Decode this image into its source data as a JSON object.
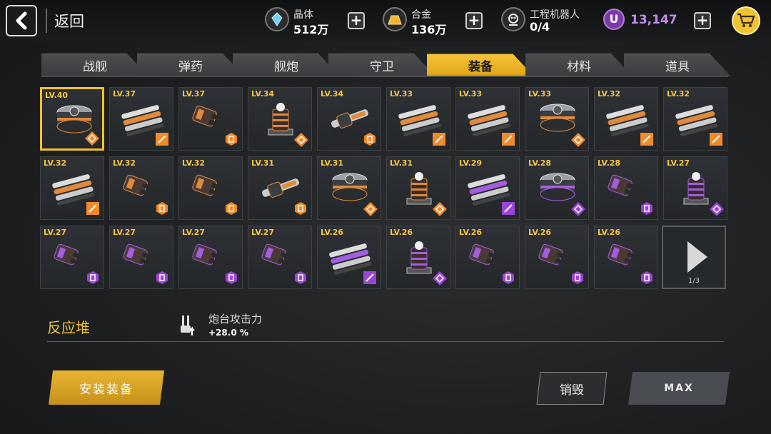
{
  "header": {
    "back_label": "返回",
    "resources": [
      {
        "name": "crystal-icon",
        "label": "晶体",
        "value": "512万"
      },
      {
        "name": "alloy-icon",
        "label": "合金",
        "value": "136万"
      },
      {
        "name": "robot-icon",
        "label": "工程机器人",
        "value": "0/4"
      }
    ],
    "currency_value": "13,147",
    "currency_icon_letter": "U"
  },
  "tabs": [
    {
      "label": "战舰",
      "active": false
    },
    {
      "label": "弹药",
      "active": false
    },
    {
      "label": "舰炮",
      "active": false
    },
    {
      "label": "守卫",
      "active": false
    },
    {
      "label": "装备",
      "active": true
    },
    {
      "label": "材料",
      "active": false
    },
    {
      "label": "道具",
      "active": false
    }
  ],
  "items": [
    {
      "level": "LV.40",
      "type": "core",
      "tier": "orange",
      "badge": "diamond",
      "selected": true
    },
    {
      "level": "LV.37",
      "type": "armor",
      "tier": "orange",
      "badge": "square"
    },
    {
      "level": "LV.37",
      "type": "cannon",
      "tier": "orange",
      "badge": "hex"
    },
    {
      "level": "LV.34",
      "type": "tower",
      "tier": "orange",
      "badge": "diamond"
    },
    {
      "level": "LV.34",
      "type": "rail",
      "tier": "orange",
      "badge": "hex"
    },
    {
      "level": "LV.33",
      "type": "armor",
      "tier": "orange",
      "badge": "square"
    },
    {
      "level": "LV.33",
      "type": "armor",
      "tier": "orange",
      "badge": "square"
    },
    {
      "level": "LV.33",
      "type": "core",
      "tier": "orange",
      "badge": "diamond"
    },
    {
      "level": "LV.32",
      "type": "armor",
      "tier": "orange",
      "badge": "square"
    },
    {
      "level": "LV.32",
      "type": "armor",
      "tier": "orange",
      "badge": "square"
    },
    {
      "level": "LV.32",
      "type": "armor",
      "tier": "orange",
      "badge": "square"
    },
    {
      "level": "LV.32",
      "type": "cannon",
      "tier": "orange",
      "badge": "hex"
    },
    {
      "level": "LV.32",
      "type": "cannon",
      "tier": "orange",
      "badge": "hex"
    },
    {
      "level": "LV.31",
      "type": "rail",
      "tier": "orange",
      "badge": "hex"
    },
    {
      "level": "LV.31",
      "type": "core",
      "tier": "orange",
      "badge": "diamond"
    },
    {
      "level": "LV.31",
      "type": "tower",
      "tier": "orange",
      "badge": "diamond"
    },
    {
      "level": "LV.29",
      "type": "armor",
      "tier": "purple",
      "badge": "square"
    },
    {
      "level": "LV.28",
      "type": "core",
      "tier": "purple",
      "badge": "diamond"
    },
    {
      "level": "LV.28",
      "type": "cannon",
      "tier": "purple",
      "badge": "hex"
    },
    {
      "level": "LV.27",
      "type": "tower",
      "tier": "purple",
      "badge": "diamond"
    },
    {
      "level": "LV.27",
      "type": "cannon",
      "tier": "purple",
      "badge": "hex"
    },
    {
      "level": "LV.27",
      "type": "cannon",
      "tier": "purple",
      "badge": "hex"
    },
    {
      "level": "LV.27",
      "type": "cannon",
      "tier": "purple",
      "badge": "hex"
    },
    {
      "level": "LV.27",
      "type": "cannon",
      "tier": "purple",
      "badge": "hex"
    },
    {
      "level": "LV.26",
      "type": "armor",
      "tier": "purple",
      "badge": "square"
    },
    {
      "level": "LV.26",
      "type": "tower",
      "tier": "purple",
      "badge": "diamond"
    },
    {
      "level": "LV.26",
      "type": "cannon",
      "tier": "purple",
      "badge": "hex"
    },
    {
      "level": "LV.26",
      "type": "cannon",
      "tier": "purple",
      "badge": "hex"
    },
    {
      "level": "LV.26",
      "type": "cannon",
      "tier": "purple",
      "badge": "hex"
    }
  ],
  "pager": {
    "text": "1/3"
  },
  "detail": {
    "section_title": "反应堆",
    "stat_label": "炮台攻击力",
    "stat_value": "+28.0 %"
  },
  "buttons": {
    "install": "安装装备",
    "destroy": "销毁",
    "max": "MAX"
  },
  "colors": {
    "orange": "#f08a2a",
    "purple": "#9b45d6",
    "gold": "#f2c12e"
  }
}
